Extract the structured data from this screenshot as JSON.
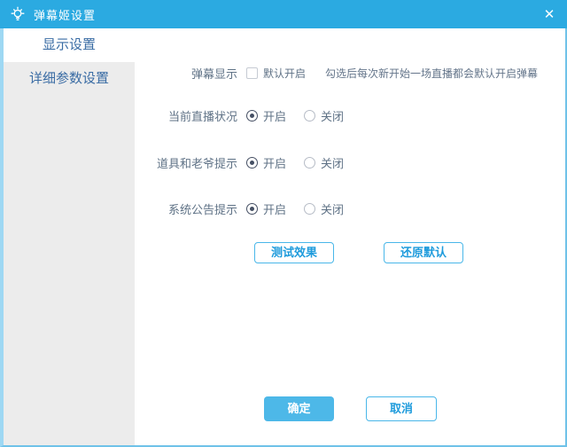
{
  "window": {
    "title": "弹幕姬设置",
    "close": "✕"
  },
  "sidebar": {
    "items": [
      {
        "label": "显示设置",
        "active": true
      },
      {
        "label": "详细参数设置",
        "active": false
      }
    ]
  },
  "content": {
    "danmu_row": {
      "label": "弹幕显示",
      "checkbox_label": "默认开启",
      "checkbox_checked": false,
      "hint": "勾选后每次新开始一场直播都会默认开启弹幕"
    },
    "radio_rows": [
      {
        "label": "当前直播状况",
        "on": "开启",
        "off": "关闭",
        "selected": "开启"
      },
      {
        "label": "道具和老爷提示",
        "on": "开启",
        "off": "关闭",
        "selected": "开启"
      },
      {
        "label": "系统公告提示",
        "on": "开启",
        "off": "关闭",
        "selected": "开启"
      }
    ],
    "secondary_buttons": {
      "test": "测试效果",
      "restore": "还原默认"
    },
    "footer_buttons": {
      "ok": "确定",
      "cancel": "取消"
    }
  },
  "colors": {
    "titlebar": "#2BAAE1",
    "accent_blue": "#2BA9E0",
    "window_border": "#6FC2E8",
    "sidebar_bg": "#ECECEC",
    "sidebar_text": "#3A6CA4",
    "label_text": "#5F7286",
    "radio_selected": "#454F63",
    "ok_button_bg": "#4DB8E8",
    "button_text_blue": "#1E9BDC"
  }
}
